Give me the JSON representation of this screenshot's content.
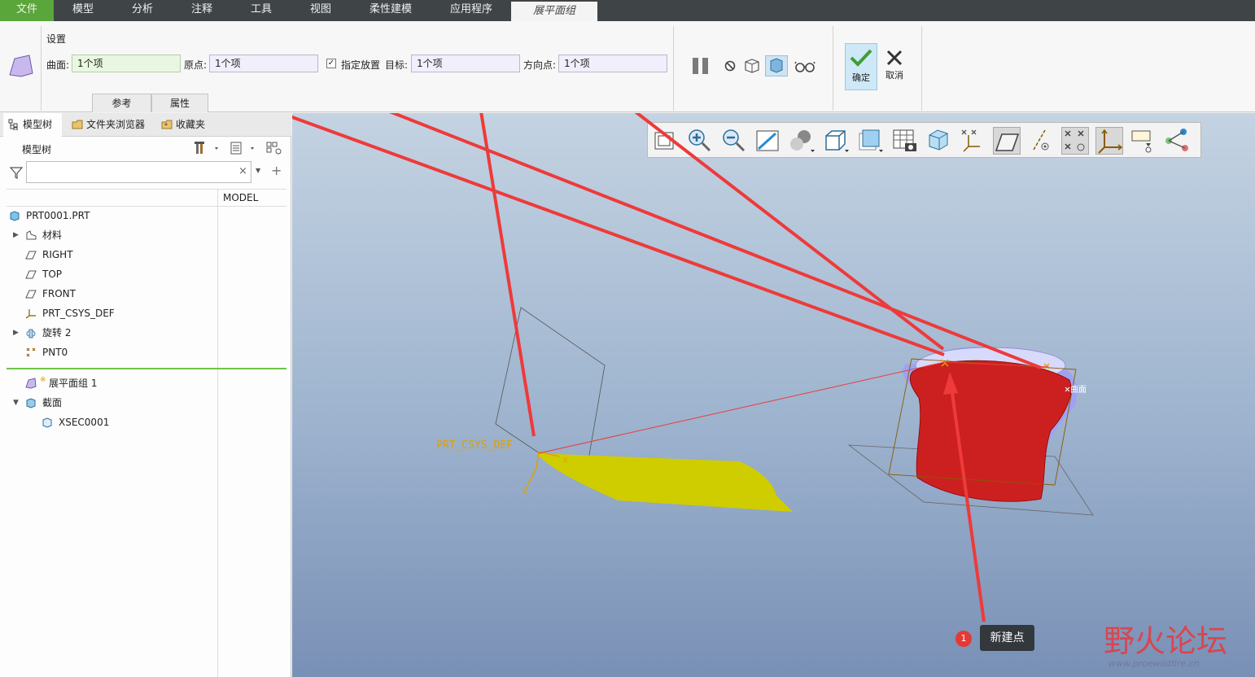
{
  "menu": {
    "tabs": [
      "文件",
      "模型",
      "分析",
      "注释",
      "工具",
      "视图",
      "柔性建模",
      "应用程序",
      "展平面组"
    ],
    "active_tab": "展平面组"
  },
  "ribbon": {
    "section_title": "设置",
    "surface_label": "曲面:",
    "surface_value": "1个项",
    "origin_label": "原点:",
    "origin_value": "1个项",
    "placement_checkbox_label": "指定放置",
    "placement_checked": true,
    "target_label": "目标:",
    "target_value": "1个项",
    "direction_label": "方向点:",
    "direction_value": "1个项",
    "subtabs": [
      "参考",
      "属性"
    ],
    "ok_label": "确定",
    "cancel_label": "取消"
  },
  "panel": {
    "tabs": [
      "模型树",
      "文件夹浏览器",
      "收藏夹"
    ],
    "header": "模型树",
    "search_placeholder": "",
    "column_header": "MODEL",
    "tree": [
      {
        "label": "PRT0001.PRT",
        "icon": "part-icon",
        "level": 0,
        "expander": false
      },
      {
        "label": "材料",
        "icon": "material-icon",
        "level": 1,
        "expander": true
      },
      {
        "label": "RIGHT",
        "icon": "datum-plane-icon",
        "level": 1,
        "expander": false
      },
      {
        "label": "TOP",
        "icon": "datum-plane-icon",
        "level": 1,
        "expander": false
      },
      {
        "label": "FRONT",
        "icon": "datum-plane-icon",
        "level": 1,
        "expander": false
      },
      {
        "label": "PRT_CSYS_DEF",
        "icon": "csys-icon",
        "level": 1,
        "expander": false
      },
      {
        "label": "旋转 2",
        "icon": "revolve-icon",
        "level": 1,
        "expander": true
      },
      {
        "label": "PNT0",
        "icon": "datum-point-icon",
        "level": 1,
        "expander": false
      }
    ],
    "tree_after_insert": [
      {
        "label": "展平面组 1",
        "icon": "flatten-quilt-icon",
        "level": 1,
        "expander": false
      },
      {
        "label": "截面",
        "icon": "section-icon",
        "level": 1,
        "expander": true
      },
      {
        "label": "XSEC0001",
        "icon": "section-icon",
        "level": 2,
        "expander": false
      }
    ]
  },
  "viewport": {
    "csys_label": "PRT_CSYS_DEF",
    "surface_tag": "曲面",
    "callout_number": "1",
    "callout_text": "新建点",
    "watermark_text": "野火论坛",
    "watermark_url": "www.proewildfire.cn"
  },
  "colors": {
    "menu_bg": "#3f4447",
    "file_tab": "#5ba63a",
    "arrow": "#ee3a3a",
    "flat_surface": "#cfcc00",
    "solid_red": "#cc2020",
    "solid_inner": "#9fa2f0"
  }
}
